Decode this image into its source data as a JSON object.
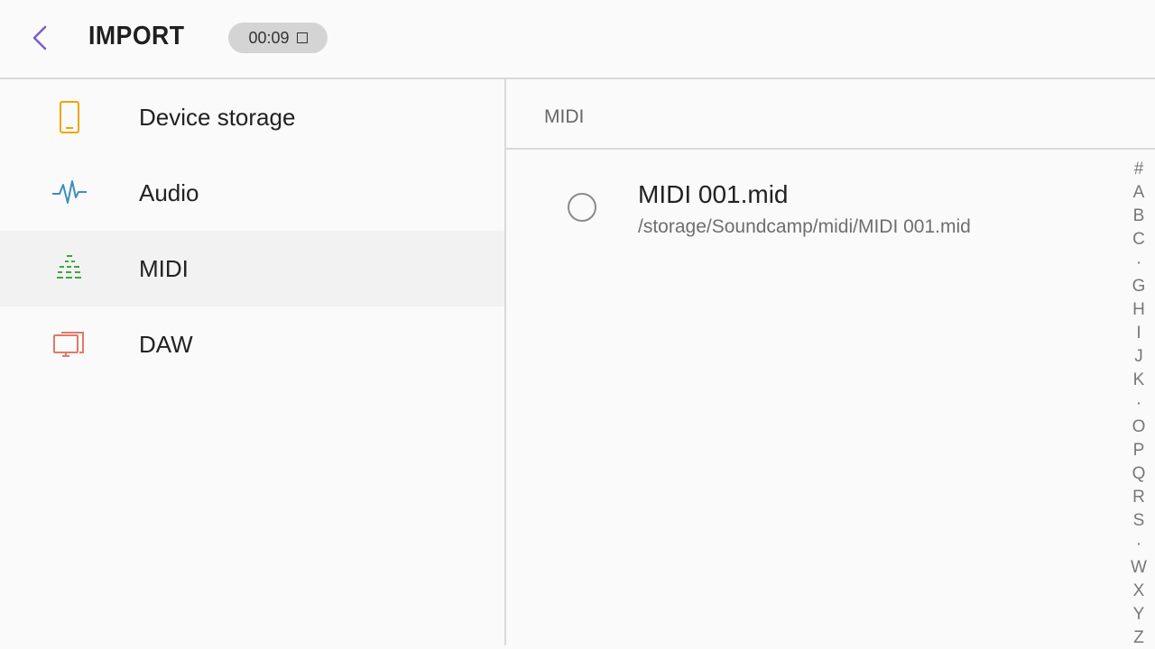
{
  "header": {
    "title": "IMPORT",
    "timer": "00:09",
    "back_icon": "chevron-left-icon",
    "stop_icon": "stop-square-icon",
    "accent_color": "#7b5fc7"
  },
  "sidebar": {
    "items": [
      {
        "label": "Device storage",
        "icon": "phone-icon",
        "color": "#f0a500"
      },
      {
        "label": "Audio",
        "icon": "waveform-icon",
        "color": "#3d8fb8"
      },
      {
        "label": "MIDI",
        "icon": "midi-bars-icon",
        "color": "#3aa83a",
        "selected": true
      },
      {
        "label": "DAW",
        "icon": "monitor-icon",
        "color": "#e07a6a"
      }
    ]
  },
  "main": {
    "section_title": "MIDI",
    "files": [
      {
        "name": "MIDI 001.mid",
        "path": "/storage/Soundcamp/midi/MIDI 001.mid"
      }
    ]
  },
  "index_bar": [
    "#",
    "A",
    "B",
    "C",
    "·",
    "G",
    "H",
    "I",
    "J",
    "K",
    "·",
    "O",
    "P",
    "Q",
    "R",
    "S",
    "·",
    "W",
    "X",
    "Y",
    "Z"
  ]
}
